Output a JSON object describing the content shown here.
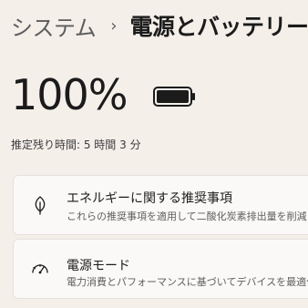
{
  "breadcrumb": {
    "parent": "システム",
    "separator": "›",
    "current": "電源とバッテリー"
  },
  "battery": {
    "percent_label": "100%",
    "level": 1.0,
    "estimate": "推定残り時間: 5 時間 3 分"
  },
  "cards": [
    {
      "icon": "leaf-icon",
      "title": "エネルギーに関する推奨事項",
      "subtitle": "これらの推奨事項を適用して二酸化炭素排出量を削減"
    },
    {
      "icon": "gauge-icon",
      "title": "電源モード",
      "subtitle": "電力消費とパフォーマンスに基づいてデバイスを最適化"
    }
  ],
  "colors": {
    "background": "#f5efea",
    "card": "#fbf9f7",
    "text_primary": "#1b1b1b",
    "text_secondary": "#5e5e5e"
  }
}
